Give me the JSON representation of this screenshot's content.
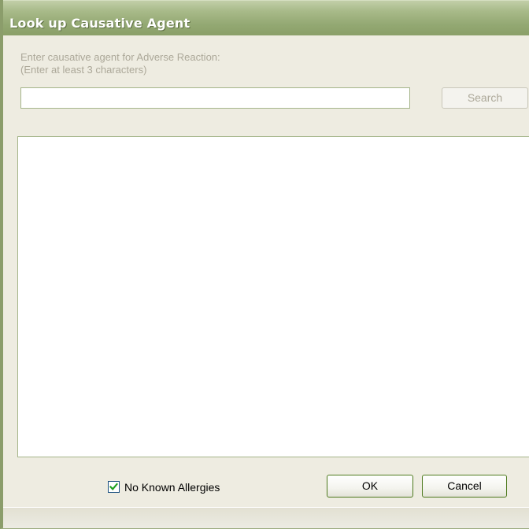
{
  "window": {
    "title": "Look up Causative Agent"
  },
  "search": {
    "prompt_line1": "Enter causative agent for Adverse Reaction:",
    "prompt_line2": "(Enter at least 3 characters)",
    "value": "",
    "button_label": "Search"
  },
  "results": {
    "items": []
  },
  "footer": {
    "no_known_allergies_label": "No Known Allergies",
    "no_known_allergies_checked": true,
    "ok_label": "OK",
    "cancel_label": "Cancel"
  },
  "colors": {
    "titlebar": "#93a872",
    "dialog_bg": "#eeece1",
    "disabled_text": "#aca899",
    "button_border": "#4e7a1e"
  }
}
